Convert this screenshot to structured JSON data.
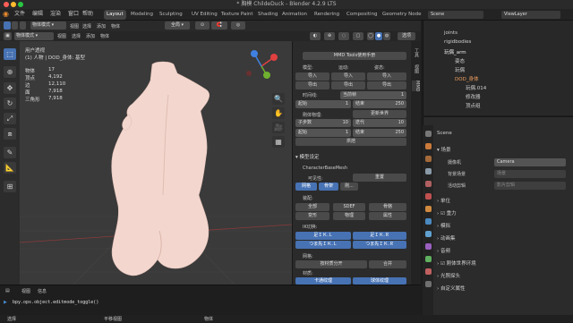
{
  "window": {
    "title": "* 胸模 ChildeDuck - Blender 4.2.9 LTS"
  },
  "menu": [
    "文件",
    "编辑",
    "渲染",
    "窗口",
    "帮助"
  ],
  "workspaces": [
    "Layout",
    "Modeling",
    "Sculpting",
    "UV Editing",
    "Texture Paint",
    "Shading",
    "Animation",
    "Rendering",
    "Compositing",
    "Geometry Node"
  ],
  "scene": {
    "label": "Scene",
    "view_layer": "ViewLayer"
  },
  "header": {
    "mode": "物体模式",
    "view": "视图",
    "select": "选择",
    "add": "添加",
    "object": "物体",
    "orientation": "全局",
    "options": "选项"
  },
  "viewport": {
    "title": "用户透视",
    "subtitle": "(1) 人物 | DOD_身体: 基型",
    "stats": [
      {
        "k": "物体",
        "v": "17"
      },
      {
        "k": "顶点",
        "v": "4,192"
      },
      {
        "k": "边",
        "v": "12,110"
      },
      {
        "k": "面",
        "v": "7,918"
      },
      {
        "k": "三角形",
        "v": "7,918"
      }
    ]
  },
  "npanel": {
    "manual": "MMD Tools使用手册",
    "model": "模型:",
    "motion": "运动:",
    "pose": "姿态:",
    "import": "导入",
    "export": "导出",
    "timeline": "时间线:",
    "current_frame_label": "当前帧",
    "current_frame": "1",
    "start": "起始",
    "start_val": "1",
    "end": "结束",
    "end_val": "250",
    "rigid": "刚体物理:",
    "update_world": "更新世界",
    "substep": "子步数",
    "substep_val": "10",
    "iter": "迭代",
    "iter_val": "10",
    "start2_val": "1",
    "end2_val": "250",
    "bake": "烘焙",
    "model_settings": "模型设定",
    "model_name": "CharacterBaseMesh",
    "reset": "重置",
    "visibility": "可见性:",
    "vis_buttons": [
      "网格",
      "骨架",
      "刚..."
    ],
    "assembly": "装配:",
    "assembly_buttons": [
      "全部",
      "SDEF",
      "骨骼",
      "变形",
      "物理",
      "属性"
    ],
    "ik_toggle": "IK切换:",
    "ik_buttons": [
      "足ＩＫ.Ｌ",
      "足ＩＫ.Ｒ",
      "つま先ＩＫ.Ｌ",
      "つま先ＩＫ.Ｒ"
    ],
    "mesh": "网格:",
    "separate": "按材质分开",
    "join": "合并",
    "material": "材质:",
    "tex1": "卡通纹理",
    "tex2": "球体纹理",
    "tabs": [
      "工具",
      "视图",
      "MMD"
    ]
  },
  "outliner": {
    "rows": [
      {
        "name": "joints",
        "indent": 0
      },
      {
        "name": "rigidbodies",
        "indent": 0
      },
      {
        "name": "玩偶_arm",
        "indent": 0
      },
      {
        "name": "姿态",
        "indent": 1
      },
      {
        "name": "玩偶",
        "indent": 1
      },
      {
        "name": "DOD_身体",
        "indent": 1
      },
      {
        "name": "玩偶.014",
        "indent": 2
      },
      {
        "name": "修改器",
        "indent": 2
      },
      {
        "name": "顶点组",
        "indent": 2
      }
    ]
  },
  "properties": {
    "title": "Scene",
    "section": "场景",
    "camera_label": "摄像机",
    "camera_val": "Camera",
    "bg_label": "背景场景",
    "bg_val": "场景",
    "clip_label": "活动剪辑",
    "clip_val": "影片剪辑",
    "subpanels": [
      "单位",
      "重力",
      "模拟",
      "动画集",
      "音频",
      "刚体世界环境",
      "光照探头",
      "自定义属性"
    ]
  },
  "console": {
    "header": [
      "视图",
      "信息"
    ],
    "line": "bpy.ops.object.editmode_toggle()"
  },
  "statusbar": [
    "选择",
    "平移视图",
    "物体"
  ],
  "colors": {
    "accent": "#4772b3",
    "skin": "#f3d7cf"
  }
}
